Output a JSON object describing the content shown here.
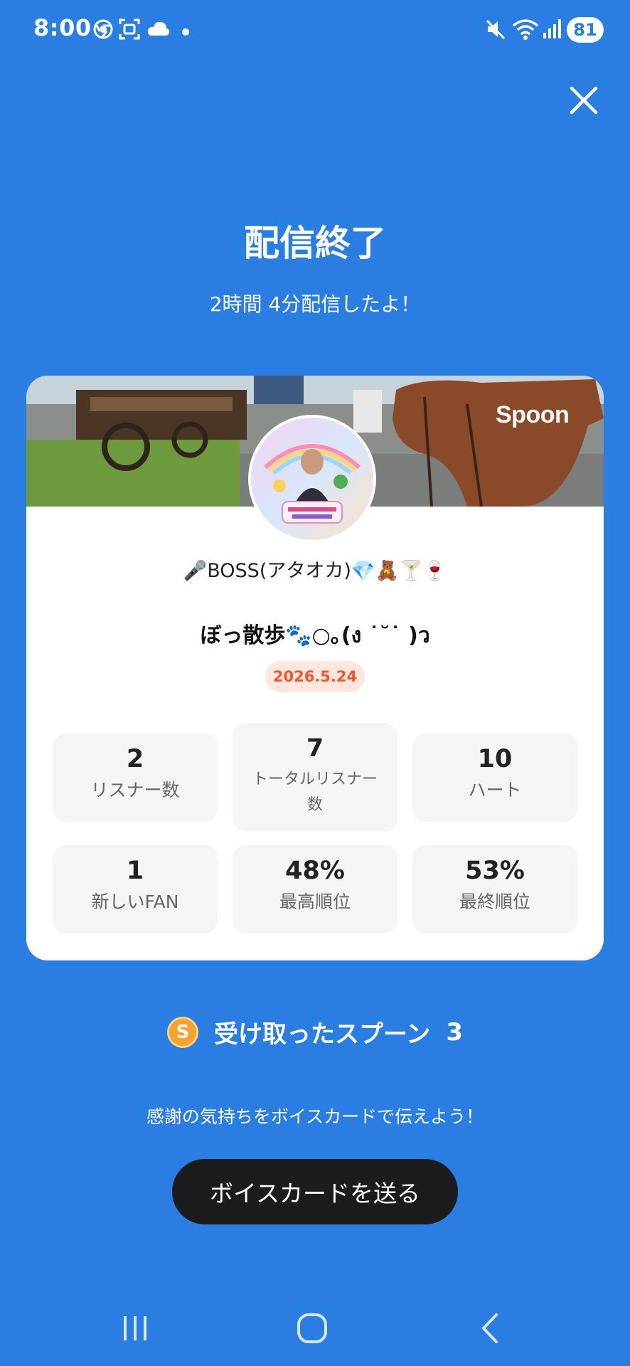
{
  "status_bar": {
    "time": "8:00",
    "battery": "81",
    "left_icons": [
      "chrome-icon",
      "screenshot-icon",
      "cloud-icon",
      "dot-icon"
    ],
    "right_icons": [
      "mute-icon",
      "wifi-icon",
      "signal-icon"
    ]
  },
  "header": {
    "title": "配信終了",
    "subtitle": "2時間 4分配信したよ！"
  },
  "card": {
    "brand": "Spoon",
    "dj_name": "🎤BOSS(アタオカ)💎🧸🍸🍷",
    "live_title": "ぼっ散歩🐾○｡(ง ˙˘˙ )ว",
    "date": "2026.5.24",
    "stats": [
      {
        "value": "2",
        "label": "リスナー数"
      },
      {
        "value": "7",
        "label": "トータルリスナー数"
      },
      {
        "value": "10",
        "label": "ハート"
      },
      {
        "value": "1",
        "label": "新しいFAN"
      },
      {
        "value": "48%",
        "label": "最高順位"
      },
      {
        "value": "53%",
        "label": "最終順位"
      }
    ]
  },
  "spoons": {
    "coin_letter": "S",
    "label": "受け取ったスプーン",
    "count": "3"
  },
  "thanks_text": "感謝の気持ちをボイスカードで伝えよう！",
  "voice_card_button": "ボイスカードを送る",
  "colors": {
    "background": "#2a7de1",
    "date_badge_text": "#f2552c",
    "date_badge_bg": "#fde8e0",
    "button_bg": "#1c1c1e",
    "spoon_coin": "#f7a22c"
  }
}
